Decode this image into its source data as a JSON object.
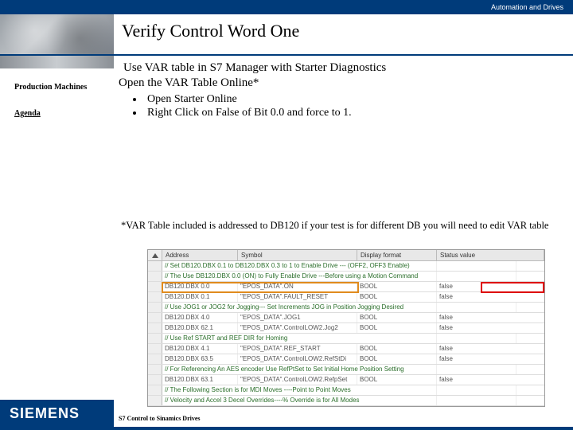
{
  "topbar": {
    "text": "Automation and Drives"
  },
  "header": {
    "title": "Verify Control Word One"
  },
  "sidebar": {
    "item1": "Production Machines",
    "item2": "Agenda"
  },
  "content": {
    "line1": "Use VAR table in S7 Manager with  Starter Diagnostics",
    "line2": "Open the VAR Table Online*",
    "bullet1": "Open Starter Online",
    "bullet2": "Right Click on False of Bit 0.0 and force to 1."
  },
  "note": "*VAR Table included is addressed to DB120 if your test is for different DB you will need to edit VAR table",
  "table": {
    "headers": {
      "addr": "Address",
      "sym": "Symbol",
      "fmt": "Display format",
      "stat": "Status value"
    },
    "rows": [
      {
        "type": "comment",
        "text": "// Set DB120.DBX 0.1 to DB120.DBX 0.3 to 1 to Enable Drive --- (OFF2, OFF3 Enable)"
      },
      {
        "type": "comment",
        "text": "// The Use DB120.DBX 0.0 (ON) to Fully Enable Drive ---Before using a Motion Command"
      },
      {
        "addr": "DB120.DBX  0.0",
        "sym": "\"EPOS_DATA\".ON",
        "fmt": "BOOL",
        "stat": "false"
      },
      {
        "addr": "DB120.DBX  0.1",
        "sym": "\"EPOS_DATA\".FAULT_RESET",
        "fmt": "BOOL",
        "stat": "false"
      },
      {
        "type": "comment",
        "text": "// Use JOG1 or JOG2 for Jogging--- Set Increments JOG in Position Jogging Desired"
      },
      {
        "addr": "DB120.DBX  4.0",
        "sym": "\"EPOS_DATA\".JOG1",
        "fmt": "BOOL",
        "stat": "false"
      },
      {
        "addr": "DB120.DBX 62.1",
        "sym": "\"EPOS_DATA\".ControlLOW2.Jog2",
        "fmt": "BOOL",
        "stat": "false"
      },
      {
        "type": "comment",
        "text": "// Use Ref START and REF DIR for Homing"
      },
      {
        "addr": "DB120.DBX  4.1",
        "sym": "\"EPOS_DATA\".REF_START",
        "fmt": "BOOL",
        "stat": "false"
      },
      {
        "addr": "DB120.DBX 63.5",
        "sym": "\"EPOS_DATA\".ControlLOW2.RefStDi",
        "fmt": "BOOL",
        "stat": "false"
      },
      {
        "type": "comment",
        "text": "// For Referencing An AES encoder Use RefPtSet to Set Initial Home Position Setting"
      },
      {
        "addr": "DB120.DBX 63.1",
        "sym": "\"EPOS_DATA\".ControlLOW2.RefpSet",
        "fmt": "BOOL",
        "stat": "false"
      },
      {
        "type": "comment",
        "text": "// The Following Section is for MDI Moves ----Point to Point Moves"
      },
      {
        "type": "comment",
        "text": "// Velocity and Accel 3 Decel Overrides----% Override is for All Modes"
      }
    ]
  },
  "footer": {
    "logo": "SIEMENS",
    "text": "S7 Control to Sinamics Drives",
    "right": ""
  }
}
